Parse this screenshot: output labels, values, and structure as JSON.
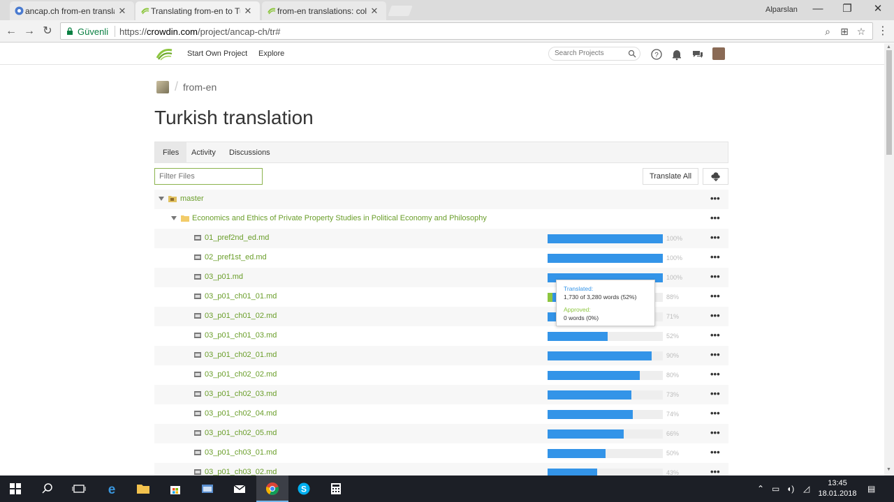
{
  "browser": {
    "tabs": [
      {
        "title": "ancap.ch from-en transla",
        "active": false
      },
      {
        "title": "Translating from-en to Tu",
        "active": true
      },
      {
        "title": "from-en translations: col",
        "active": false
      }
    ],
    "profile_name": "Alparslan",
    "secure_label": "Güvenli",
    "url_prefix": "https://",
    "url_host": "crowdin.com",
    "url_path": "/project/ancap-ch/tr#"
  },
  "site_header": {
    "start_own_project": "Start Own Project",
    "explore": "Explore",
    "search_placeholder": "Search Projects"
  },
  "breadcrumb": {
    "project": "from-en"
  },
  "page_title": "Turkish translation",
  "page_tabs": [
    "Files",
    "Activity",
    "Discussions"
  ],
  "filter_placeholder": "Filter Files",
  "translate_all_label": "Translate All",
  "tree": {
    "root": "master",
    "folder": "Economics and Ethics of Private Property Studies in Political Economy and Philosophy",
    "files": [
      {
        "name": "01_pref2nd_ed.md",
        "translated": 100,
        "approved": 0,
        "pct": "100%"
      },
      {
        "name": "02_pref1st_ed.md",
        "translated": 100,
        "approved": 0,
        "pct": "100%"
      },
      {
        "name": "03_p01.md",
        "translated": 100,
        "approved": 0,
        "pct": "100%"
      },
      {
        "name": "03_p01_ch01_01.md",
        "translated": 88,
        "approved": 4,
        "pct": "88%"
      },
      {
        "name": "03_p01_ch01_02.md",
        "translated": 71,
        "approved": 0,
        "pct": "71%"
      },
      {
        "name": "03_p01_ch01_03.md",
        "translated": 52,
        "approved": 0,
        "pct": "52%"
      },
      {
        "name": "03_p01_ch02_01.md",
        "translated": 90,
        "approved": 0,
        "pct": "90%"
      },
      {
        "name": "03_p01_ch02_02.md",
        "translated": 80,
        "approved": 0,
        "pct": "80%"
      },
      {
        "name": "03_p01_ch02_03.md",
        "translated": 73,
        "approved": 0,
        "pct": "73%"
      },
      {
        "name": "03_p01_ch02_04.md",
        "translated": 74,
        "approved": 0,
        "pct": "74%"
      },
      {
        "name": "03_p01_ch02_05.md",
        "translated": 66,
        "approved": 0,
        "pct": "66%"
      },
      {
        "name": "03_p01_ch03_01.md",
        "translated": 50,
        "approved": 0,
        "pct": "50%"
      },
      {
        "name": "03_p01_ch03_02.md",
        "translated": 43,
        "approved": 0,
        "pct": "43%"
      }
    ]
  },
  "tooltip": {
    "translated_label": "Translated:",
    "translated_value": "1,730 of 3,280 words (52%)",
    "approved_label": "Approved:",
    "approved_value": "0 words (0%)"
  },
  "taskbar": {
    "time": "13:45",
    "date": "18.01.2018"
  },
  "colors": {
    "translated_bar": "#3394e8",
    "approved_bar": "#8dc63f",
    "file_link": "#6a9e2a"
  }
}
